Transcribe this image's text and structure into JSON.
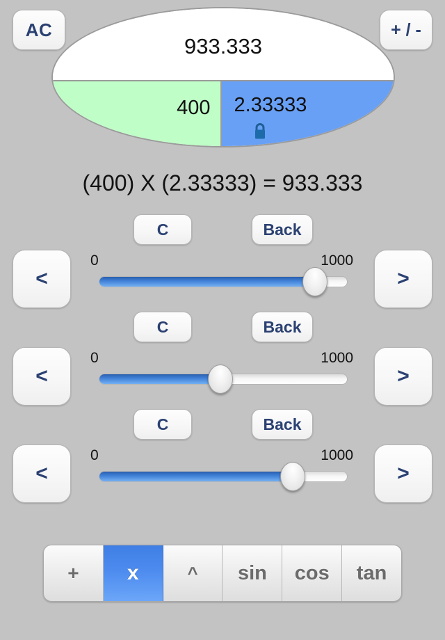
{
  "display": {
    "result": "933.333",
    "operand_a": "400",
    "operand_b": "2.33333",
    "operand_b_locked_icon": "lock-closed-icon",
    "colors": {
      "background": "#c3c3c3",
      "result_pane": "#ffffff",
      "operand_a_pane": "#bfffc7",
      "operand_b_pane": "#68a0f5",
      "accent_blue": "#2b4172",
      "selected_segment": "#4d8bef"
    }
  },
  "top_keys": {
    "all_clear": "AC",
    "sign_toggle": "+ / -"
  },
  "equation": "(400) X (2.33333) = 933.333",
  "slider_rows": [
    {
      "clear_label": "C",
      "back_label": "Back",
      "prev_label": "<",
      "next_label": ">",
      "min_label": "0",
      "max_label": "1000",
      "percent": 87
    },
    {
      "clear_label": "C",
      "back_label": "Back",
      "prev_label": "<",
      "next_label": ">",
      "min_label": "0",
      "max_label": "1000",
      "percent": 49
    },
    {
      "clear_label": "C",
      "back_label": "Back",
      "prev_label": "<",
      "next_label": ">",
      "min_label": "0",
      "max_label": "1000",
      "percent": 78
    }
  ],
  "operators": [
    {
      "label": "+",
      "selected": false
    },
    {
      "label": "x",
      "selected": true
    },
    {
      "label": "^",
      "selected": false
    },
    {
      "label": "sin",
      "selected": false
    },
    {
      "label": "cos",
      "selected": false
    },
    {
      "label": "tan",
      "selected": false
    }
  ]
}
